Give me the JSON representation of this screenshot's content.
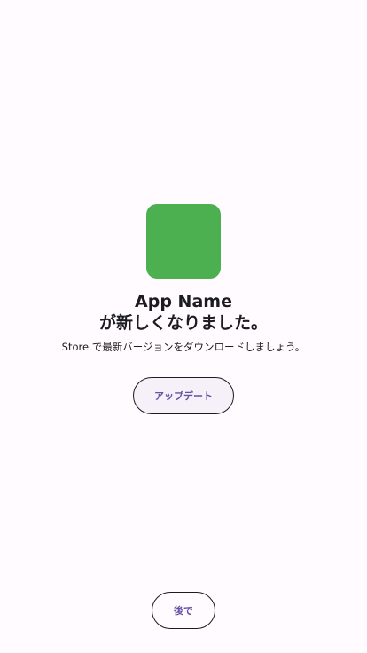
{
  "update_prompt": {
    "icon_color": "#4caf50",
    "title_line1": "App Name",
    "title_line2": "が新しくなりました。",
    "message": "Store で最新バージョンをダウンロードしましょう。",
    "update_label": "アップデート",
    "later_label": "後で",
    "accent_color": "#6750a4"
  }
}
